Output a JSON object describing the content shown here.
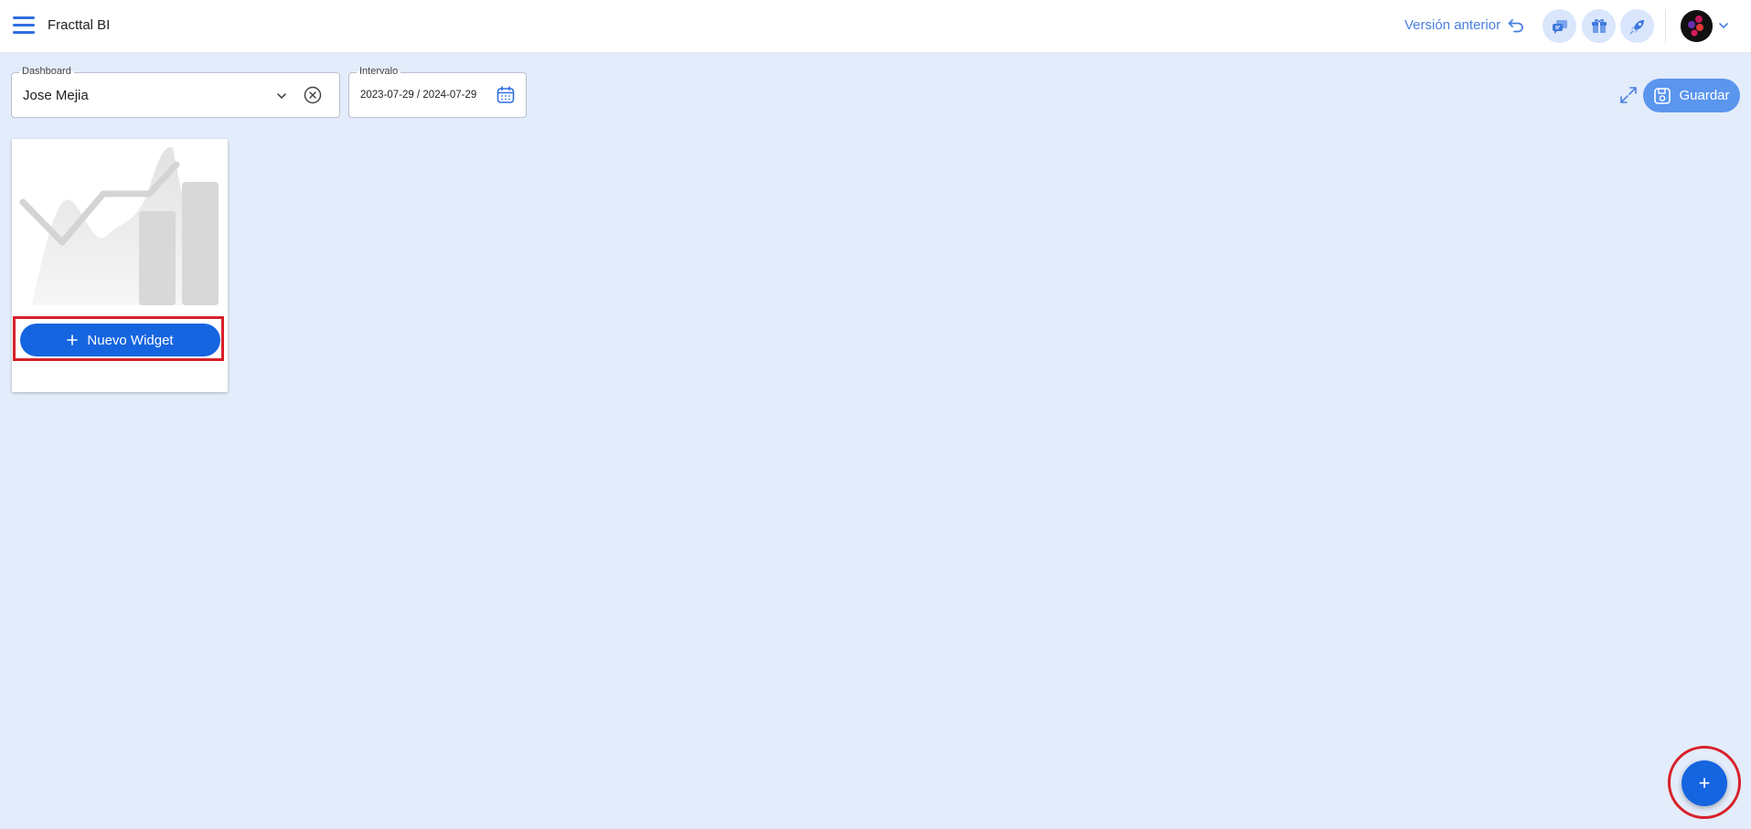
{
  "header": {
    "app_title": "Fracttal BI",
    "prev_version_label": "Versión anterior",
    "icons": [
      "chat-bubbles-icon",
      "gift-box-icon",
      "rocket-icon"
    ],
    "accent_color": "#2f6fe0"
  },
  "filters": {
    "dashboard": {
      "label": "Dashboard",
      "value": "Jose Mejia"
    },
    "interval": {
      "label": "Intervalo",
      "value": "2023-07-29 / 2024-07-29"
    }
  },
  "toolbar": {
    "save_label": "Guardar"
  },
  "widget_card": {
    "new_widget_label": "Nuevo Widget",
    "highlight_color": "#d8202a"
  },
  "fab": {
    "symbol": "+",
    "color": "#1565e0"
  }
}
